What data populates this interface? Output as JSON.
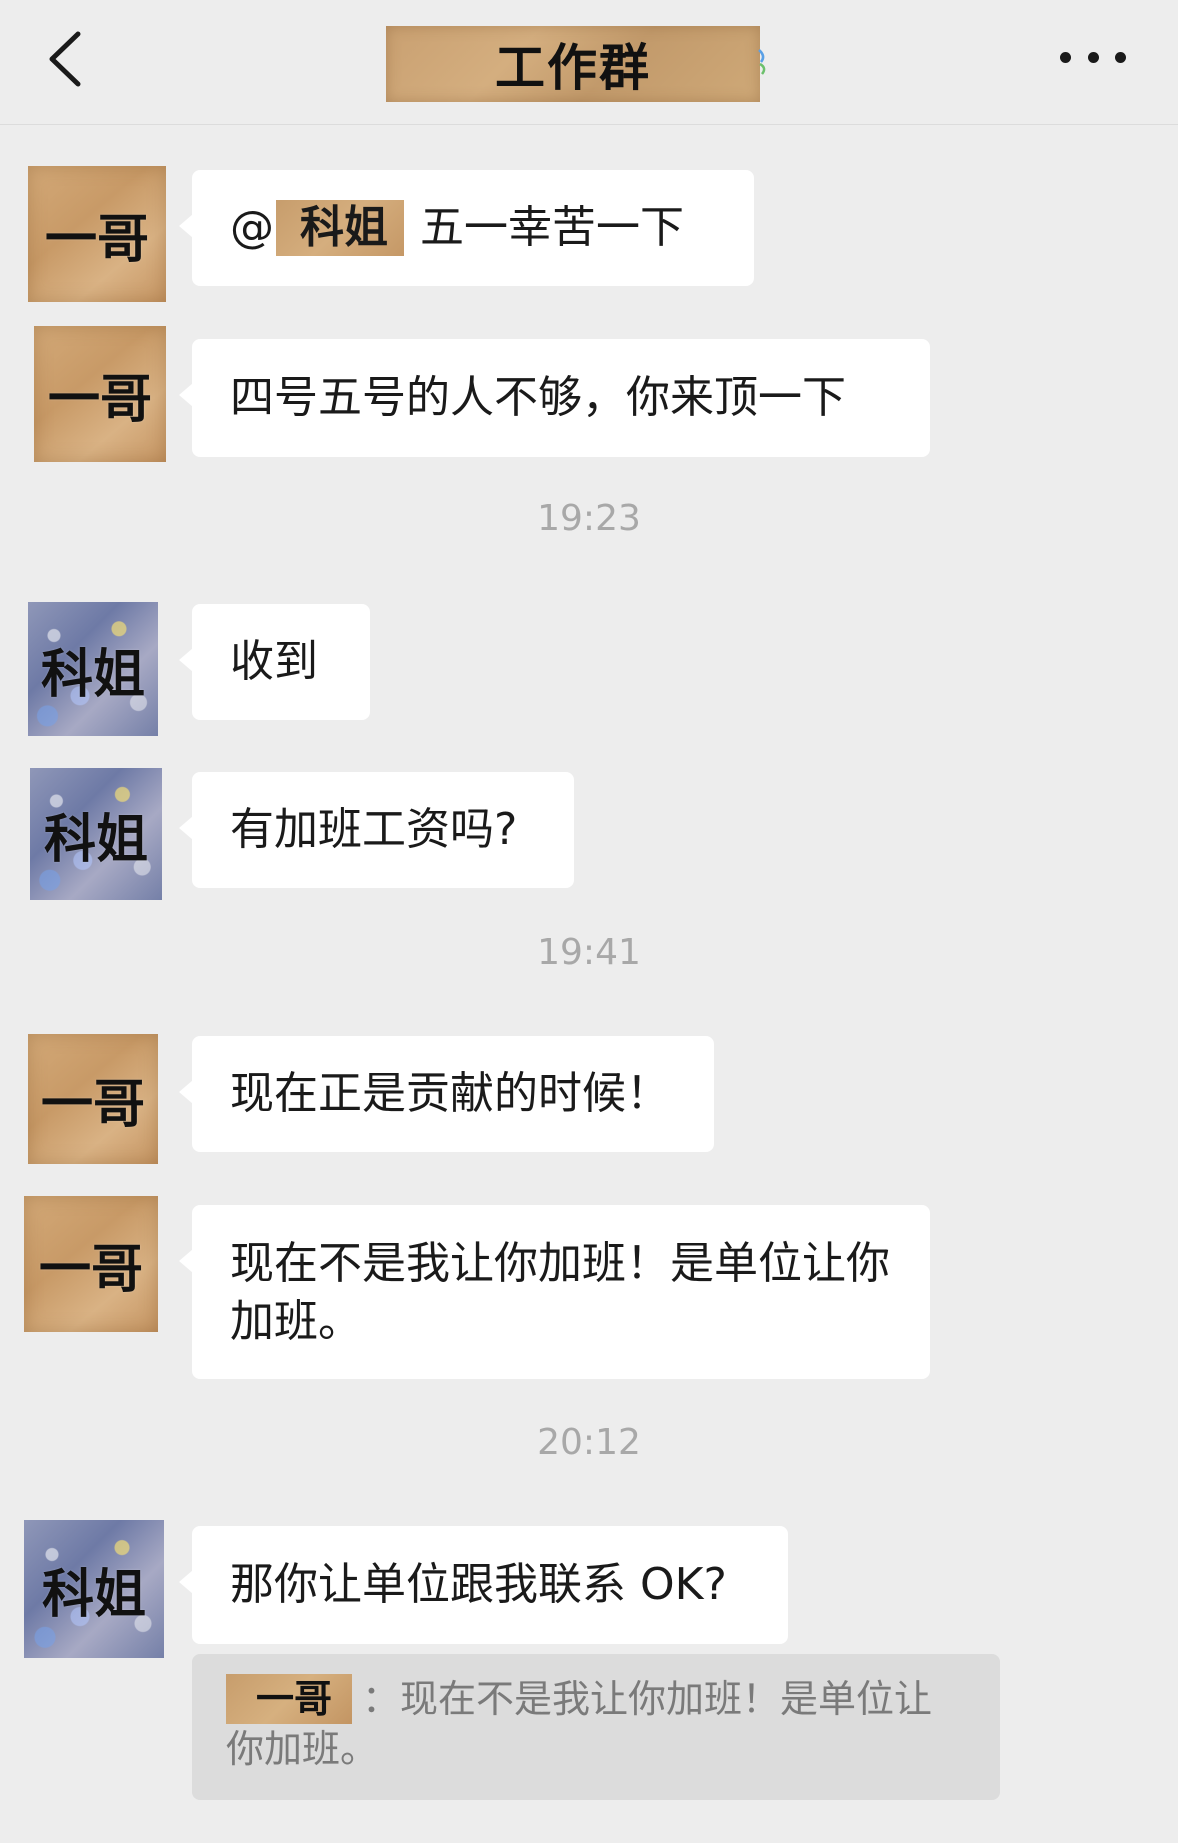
{
  "header": {
    "title": "工作群",
    "back_icon": "chevron-left-icon",
    "more_icon": "ellipsis-icon"
  },
  "colors": {
    "background": "#ededed",
    "bubble": "#ffffff",
    "timestamp": "#a8a8a8",
    "quote_background": "#dcdcdc"
  },
  "messages": [
    {
      "sender": "一哥",
      "mention": "科姐",
      "text": "五一幸苦一下"
    },
    {
      "sender": "一哥",
      "text": "四号五号的人不够，你来顶一下"
    },
    {
      "sender": "科姐",
      "text": "收到"
    },
    {
      "sender": "科姐",
      "text": "有加班工资吗?"
    },
    {
      "sender": "一哥",
      "text": "现在正是贡献的时候！"
    },
    {
      "sender": "一哥",
      "text": "现在不是我让你加班！是单位让你加班。"
    },
    {
      "sender": "科姐",
      "text": "那你让单位跟我联系 OK?"
    }
  ],
  "timestamps": [
    "19:23",
    "19:41",
    "20:12"
  ],
  "quote": {
    "sender": "一哥",
    "text": "现在不是我让你加班！是单位让你加班。"
  }
}
